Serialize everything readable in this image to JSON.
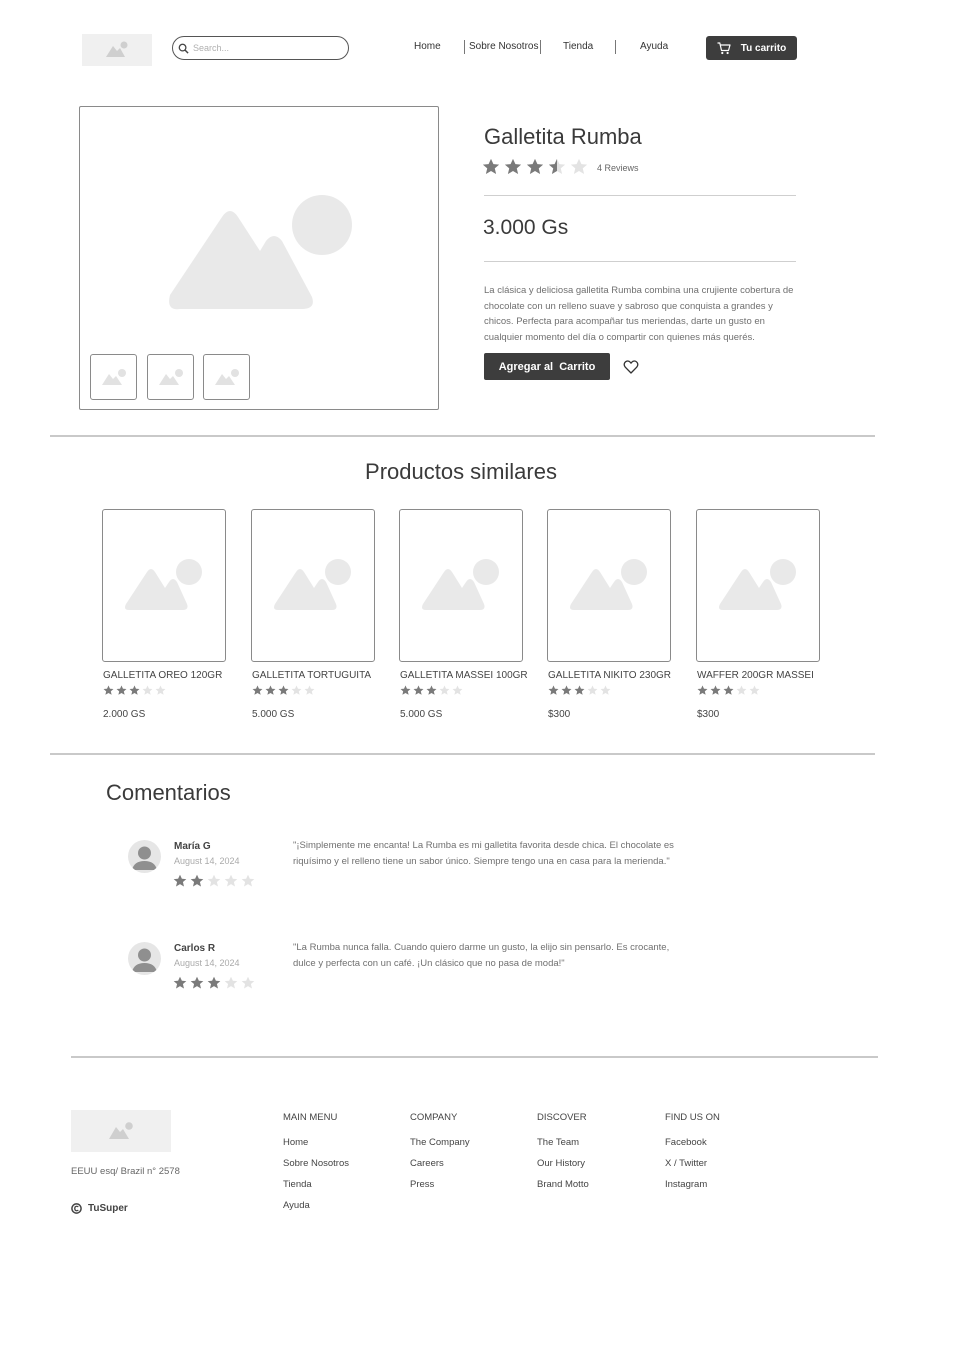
{
  "header": {
    "search_placeholder": "Search...",
    "nav": [
      "Home",
      "Sobre Nosotros",
      "Tienda",
      "Ayuda"
    ],
    "cart_label": "Tu carrito"
  },
  "product": {
    "title": "Galletita Rumba",
    "rating": 3.5,
    "rating_max": 5,
    "reviews": "4 Reviews",
    "price": "3.000 Gs",
    "description": "La clásica y deliciosa galletita Rumba combina una crujiente cobertura de chocolate con un relleno suave y sabroso que conquista a grandes y chicos. Perfecta para acompañar tus meriendas, darte un gusto en cualquier momento del día o compartir con quienes más querés.",
    "add_to_cart": "Agregar al  Carrito",
    "thumbnails": 3
  },
  "similar": {
    "title": "Productos similares",
    "items": [
      {
        "name": "GALLETITA OREO 120GR",
        "rating": 3,
        "price": "2.000 GS"
      },
      {
        "name": "GALLETITA TORTUGUITA",
        "rating": 3,
        "price": "5.000 GS"
      },
      {
        "name": "GALLETITA MASSEI 100GR",
        "rating": 3,
        "price": "5.000 GS"
      },
      {
        "name": "GALLETITA NIKITO 230GR",
        "rating": 3,
        "price": "$300"
      },
      {
        "name": "WAFFER 200GR MASSEI",
        "rating": 3,
        "price": "$300"
      }
    ]
  },
  "comments": {
    "title": "Comentarios",
    "items": [
      {
        "name": "María G",
        "date": "August 14, 2024",
        "rating": 2,
        "text": "\"¡Simplemente me encanta! La Rumba es mi galletita favorita desde chica. El chocolate es riquísimo y el relleno tiene un sabor único. Siempre tengo una en casa para la merienda.\""
      },
      {
        "name": "Carlos R",
        "date": "August 14, 2024",
        "rating": 3,
        "text": "\"La Rumba nunca falla. Cuando quiero darme un gusto, la elijo sin pensarlo. Es crocante, dulce y perfecta con un café. ¡Un clásico que no pasa de moda!\""
      }
    ]
  },
  "footer": {
    "address": "EEUU esq/ Brazil n° 2578",
    "brand": "TuSuper",
    "columns": [
      {
        "title": "MAIN MENU",
        "links": [
          "Home",
          "Sobre Nosotros",
          "Tienda",
          "Ayuda"
        ]
      },
      {
        "title": "COMPANY",
        "links": [
          "The Company",
          "Careers",
          "Press"
        ]
      },
      {
        "title": "DISCOVER",
        "links": [
          "The Team",
          "Our History",
          "Brand Motto"
        ]
      },
      {
        "title": "FIND US ON",
        "links": [
          "Facebook",
          "X / Twitter",
          "Instagram"
        ]
      }
    ]
  },
  "colors": {
    "dark_button": "#3d3d3d",
    "star_filled": "#7a7a7a",
    "star_empty": "#e3e3e3",
    "placeholder": "#e8e8e8"
  },
  "icons": [
    "image-placeholder-icon",
    "search-icon",
    "cart-icon",
    "star-icon",
    "heart-icon",
    "user-avatar-icon",
    "copyright-icon"
  ]
}
